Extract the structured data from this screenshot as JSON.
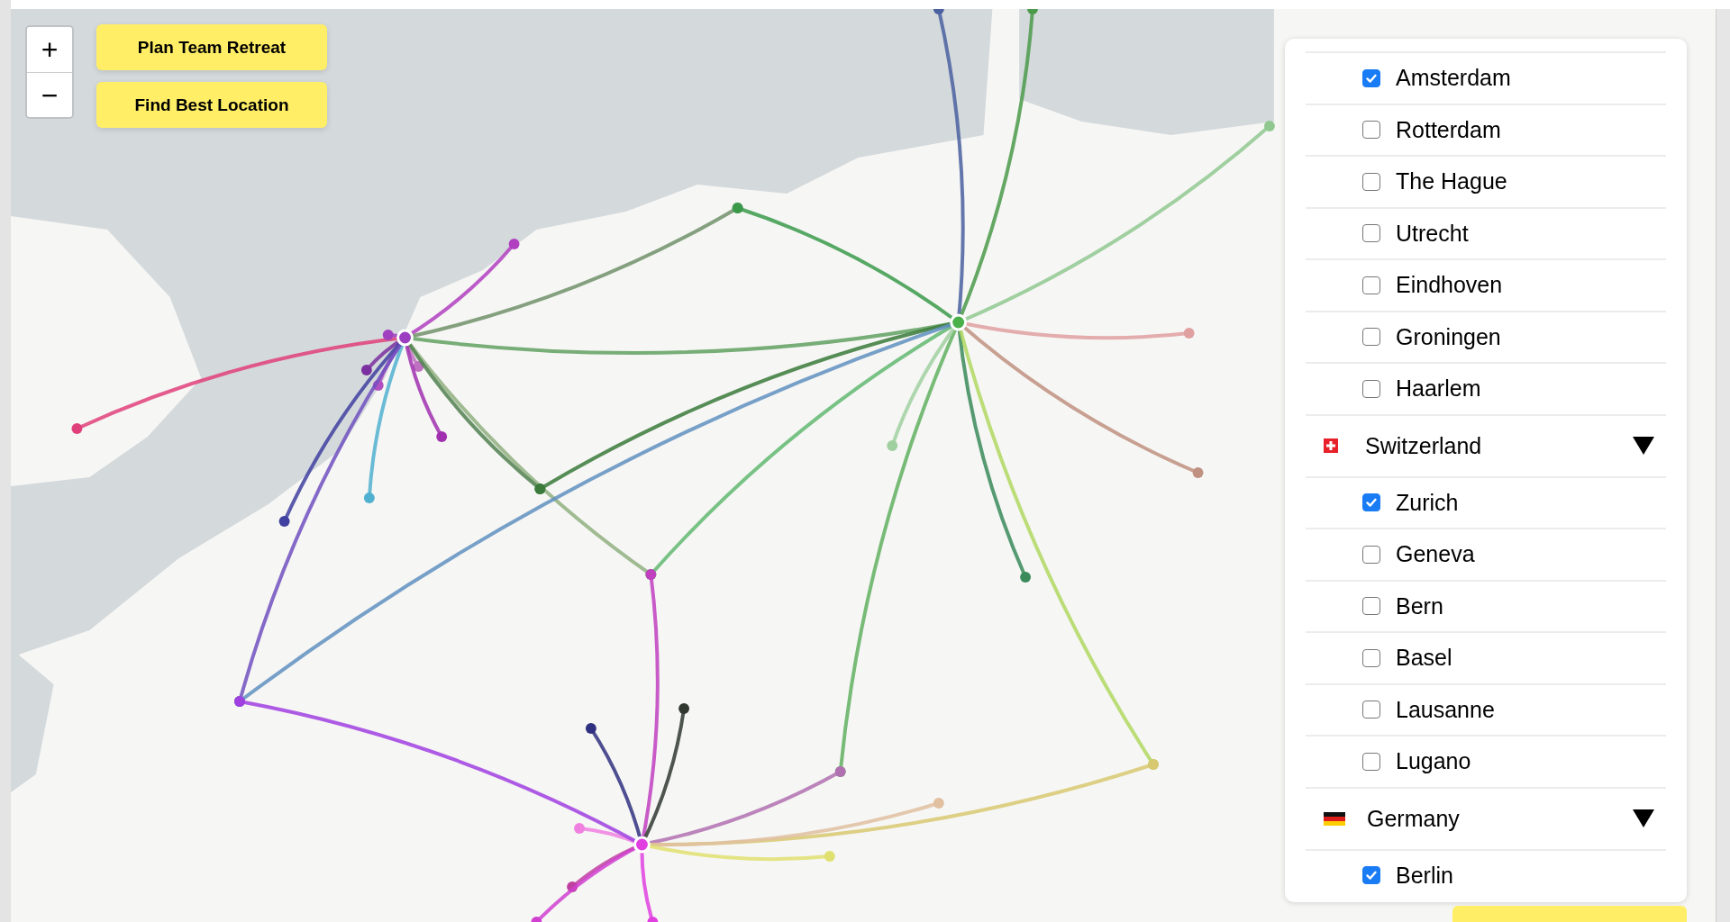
{
  "zoom_controls": [
    {
      "label": "+"
    },
    {
      "label": "−"
    }
  ],
  "actions": [
    {
      "label": "Plan Team Retreat"
    },
    {
      "label": "Find Best Location"
    }
  ],
  "panel": {
    "items": [
      {
        "kind": "city",
        "label": "Amsterdam",
        "checked": true
      },
      {
        "kind": "city",
        "label": "Rotterdam",
        "checked": false
      },
      {
        "kind": "city",
        "label": "The Hague",
        "checked": false
      },
      {
        "kind": "city",
        "label": "Utrecht",
        "checked": false
      },
      {
        "kind": "city",
        "label": "Eindhoven",
        "checked": false
      },
      {
        "kind": "city",
        "label": "Groningen",
        "checked": false
      },
      {
        "kind": "city",
        "label": "Haarlem",
        "checked": false
      },
      {
        "kind": "country",
        "label": "Switzerland",
        "flag": {
          "kind": "ch"
        },
        "expanded": true
      },
      {
        "kind": "city",
        "label": "Zurich",
        "checked": true
      },
      {
        "kind": "city",
        "label": "Geneva",
        "checked": false
      },
      {
        "kind": "city",
        "label": "Bern",
        "checked": false
      },
      {
        "kind": "city",
        "label": "Basel",
        "checked": false
      },
      {
        "kind": "city",
        "label": "Lausanne",
        "checked": false
      },
      {
        "kind": "city",
        "label": "Lugano",
        "checked": false
      },
      {
        "kind": "country",
        "label": "Germany",
        "flag": {
          "kind": "de"
        },
        "expanded": true
      },
      {
        "kind": "city",
        "label": "Berlin",
        "checked": true
      }
    ]
  }
}
